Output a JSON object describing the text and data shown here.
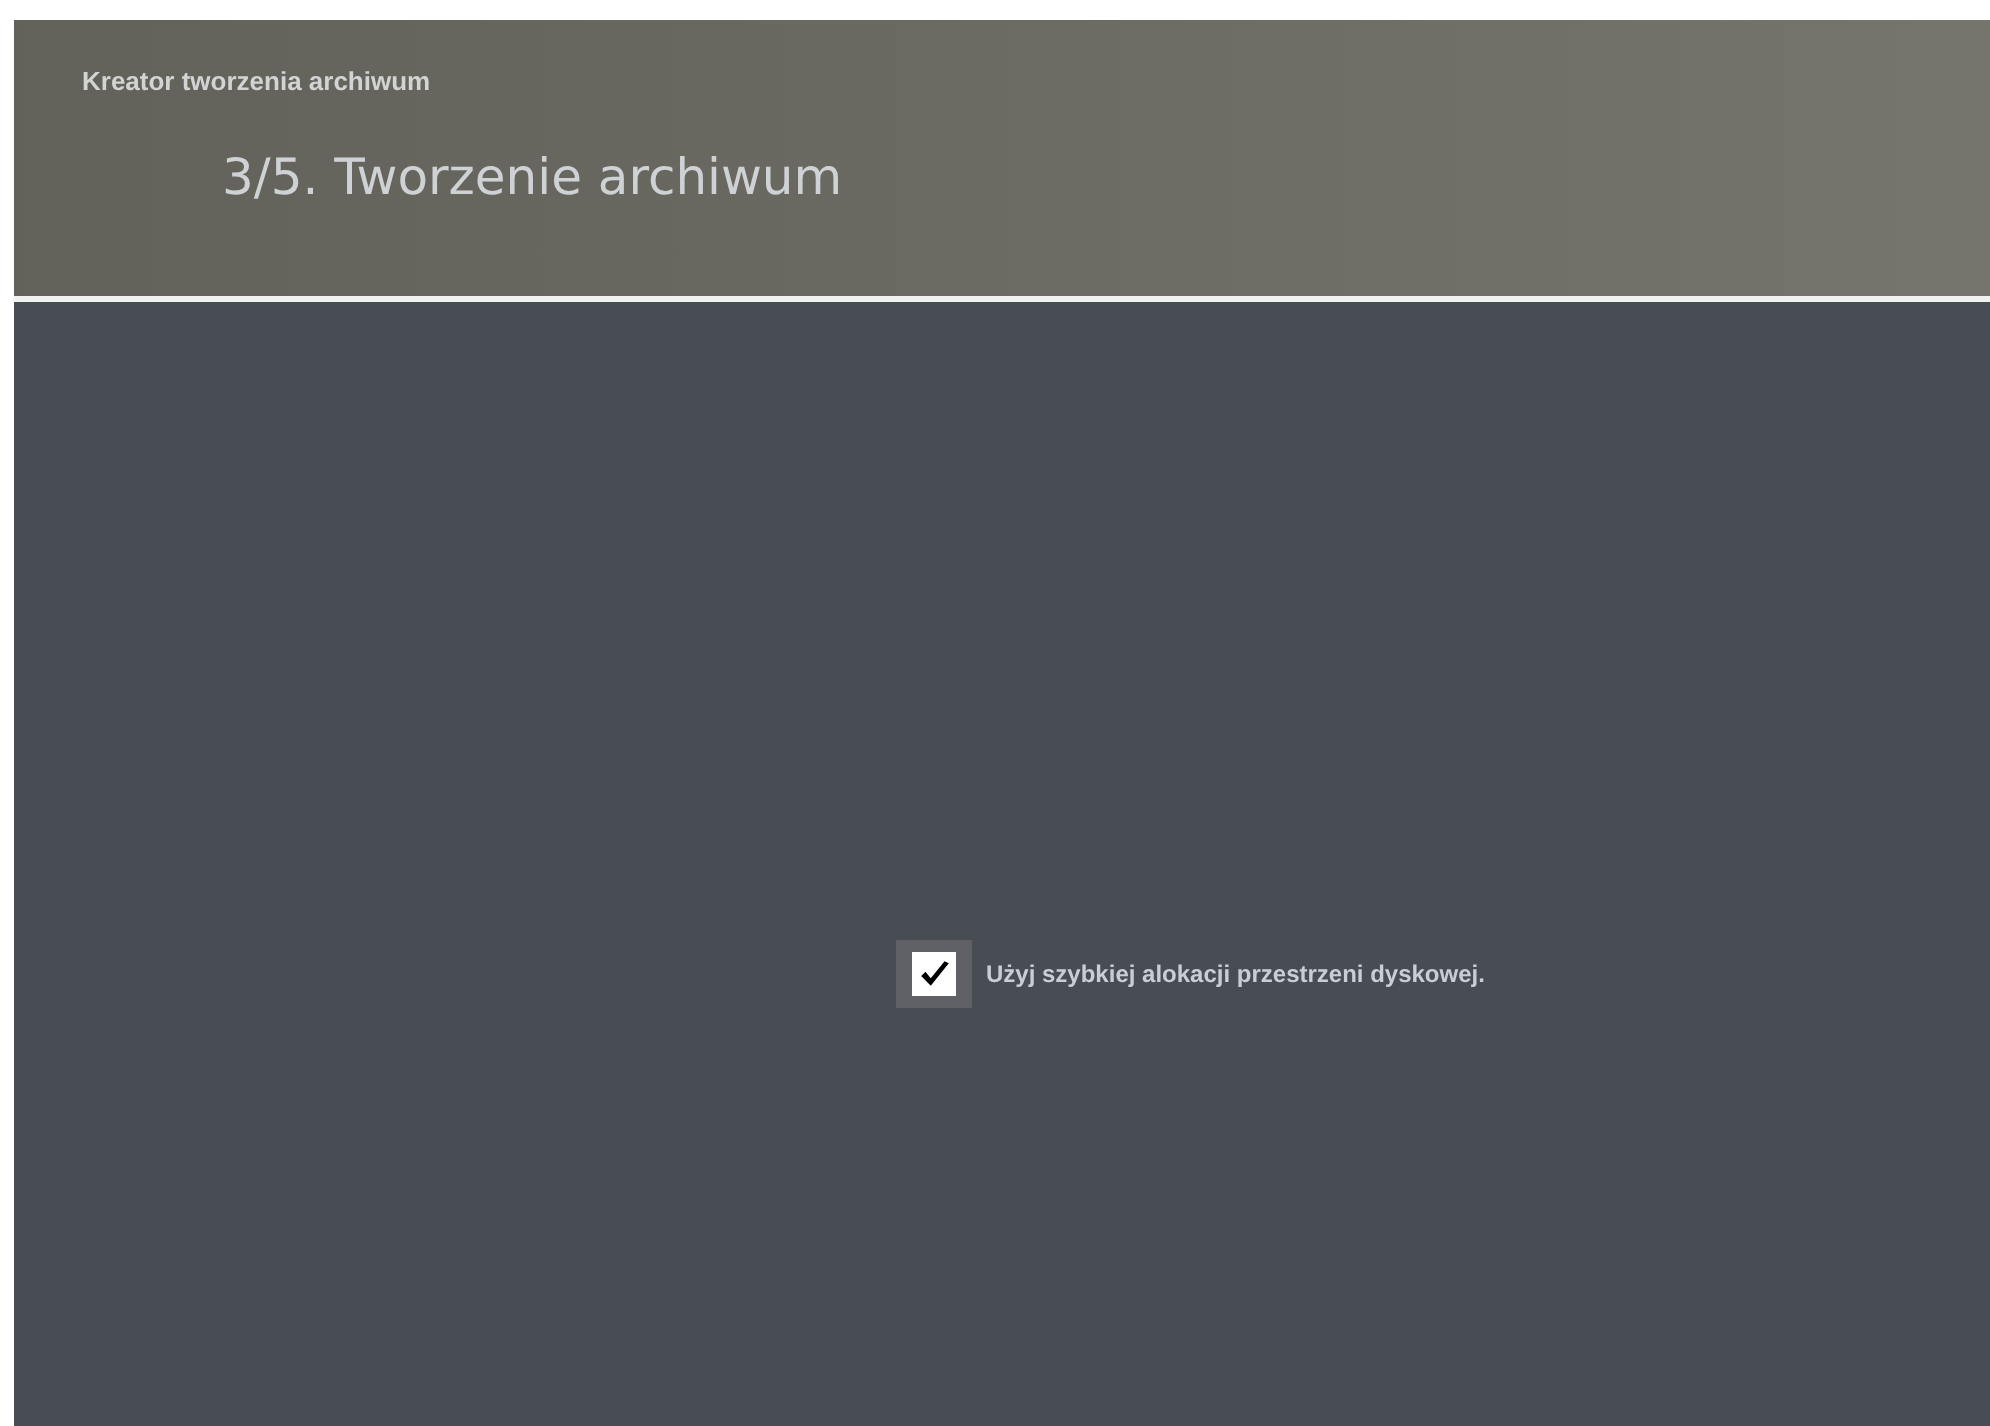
{
  "window": {
    "title": "Kreator tworzenia archiwum"
  },
  "step": {
    "title": "3/5. Tworzenie archiwum"
  },
  "options": [
    {
      "kind": "checkbox",
      "label": "Użyj szybkiej alokacji przestrzeni dyskowej.",
      "checked": true
    }
  ]
}
